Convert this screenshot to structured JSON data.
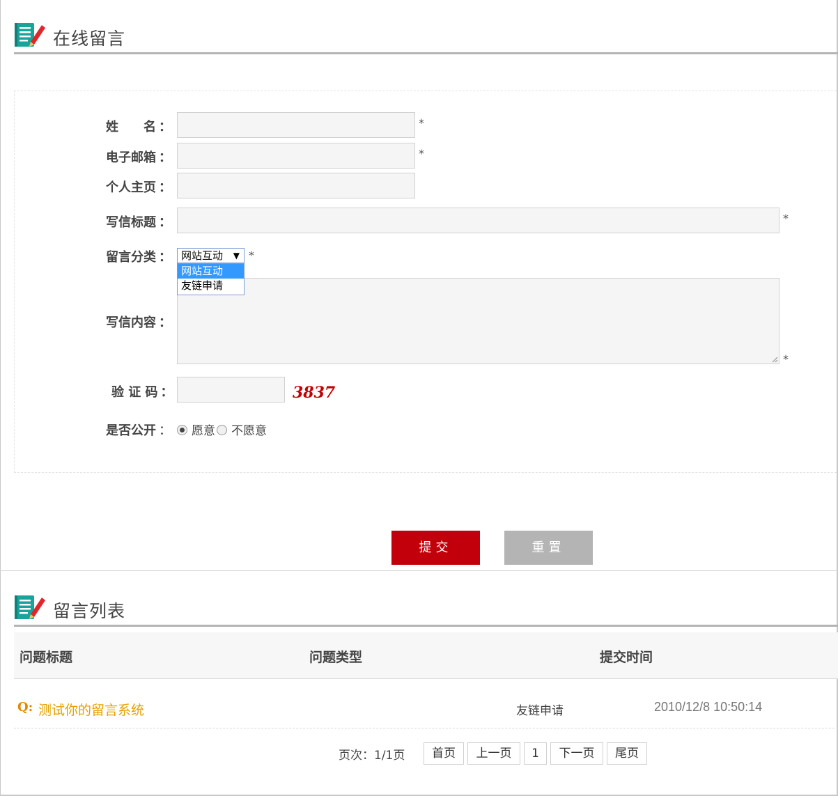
{
  "form_section": {
    "title": "在线留言"
  },
  "form": {
    "name_label": "姓　　名",
    "email_label": "电子邮箱",
    "homepage_label": "个人主页",
    "subject_label": "写信标题",
    "category_label": "留言分类",
    "content_label": "写信内容",
    "captcha_label": "验 证 码",
    "public_label": "是否公开",
    "colon": "：",
    "required_mark": "*",
    "name_value": "",
    "email_value": "",
    "homepage_value": "",
    "subject_value": "",
    "content_value": "",
    "captcha_value": "",
    "captcha_code": "3837",
    "category_selected": "网站互动",
    "category_options": [
      "网站互动",
      "友链申请"
    ],
    "public_options": [
      {
        "label": "愿意",
        "checked": true
      },
      {
        "label": "不愿意",
        "checked": false
      }
    ]
  },
  "buttons": {
    "submit": "提交",
    "reset": "重置"
  },
  "list_section": {
    "title": "留言列表"
  },
  "table": {
    "headers": [
      "问题标题",
      "问题类型",
      "提交时间"
    ],
    "rows": [
      {
        "q": "Q:",
        "title": "测试你的留言系统",
        "type": "友链申请",
        "time": "2010/12/8 10:50:14"
      }
    ]
  },
  "pagination": {
    "info": "页次：1/1页",
    "first": "首页",
    "prev": "上一页",
    "current": "1",
    "next": "下一页",
    "last": "尾页"
  },
  "colors": {
    "accent": "#c2000c",
    "link": "#e6a000",
    "select_highlight": "#3399ff"
  }
}
